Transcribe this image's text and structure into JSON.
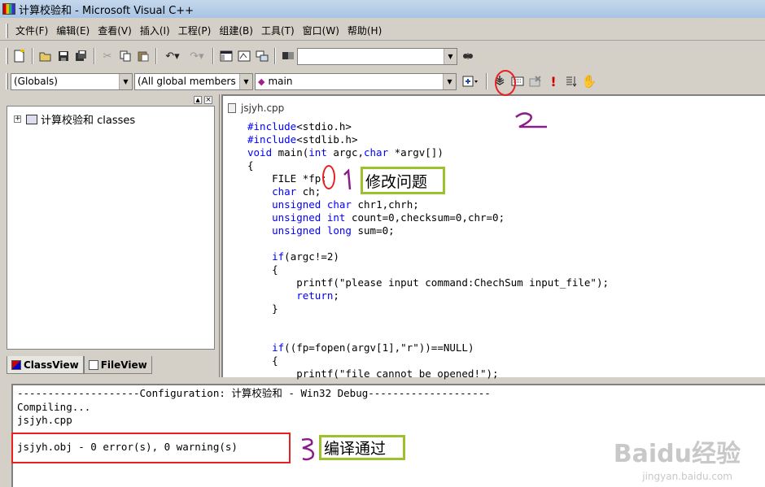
{
  "window": {
    "title": "计算校验和 - Microsoft Visual C++"
  },
  "menu": [
    "文件(F)",
    "编辑(E)",
    "查看(V)",
    "插入(I)",
    "工程(P)",
    "组建(B)",
    "工具(T)",
    "窗口(W)",
    "帮助(H)"
  ],
  "toolbar": {
    "find_combo_value": "",
    "globals_combo": "(Globals)",
    "members_combo": "(All global members",
    "function_combo": "main"
  },
  "workspace": {
    "tree_root": "计算校验和 classes",
    "tabs": [
      "ClassView",
      "FileView"
    ]
  },
  "editor": {
    "filename": "jsjyh.cpp",
    "lines": [
      [
        {
          "t": "#include",
          "k": 1
        },
        {
          "t": "<stdio.h>"
        }
      ],
      [
        {
          "t": "#include",
          "k": 1
        },
        {
          "t": "<stdlib.h>"
        }
      ],
      [
        {
          "t": "void",
          "k": 1
        },
        {
          "t": " main("
        },
        {
          "t": "int",
          "k": 1
        },
        {
          "t": " argc,"
        },
        {
          "t": "char",
          "k": 1
        },
        {
          "t": " *argv[])"
        }
      ],
      [
        {
          "t": "{"
        }
      ],
      [
        {
          "t": "    FILE *fp;"
        }
      ],
      [
        {
          "t": "    "
        },
        {
          "t": "char",
          "k": 1
        },
        {
          "t": " ch;"
        }
      ],
      [
        {
          "t": "    "
        },
        {
          "t": "unsigned",
          "k": 1
        },
        {
          "t": " "
        },
        {
          "t": "char",
          "k": 1
        },
        {
          "t": " chr1,chrh;"
        }
      ],
      [
        {
          "t": "    "
        },
        {
          "t": "unsigned",
          "k": 1
        },
        {
          "t": " "
        },
        {
          "t": "int",
          "k": 1
        },
        {
          "t": " count=0,checksum=0,chr=0;"
        }
      ],
      [
        {
          "t": "    "
        },
        {
          "t": "unsigned",
          "k": 1
        },
        {
          "t": " "
        },
        {
          "t": "long",
          "k": 1
        },
        {
          "t": " sum=0;"
        }
      ],
      [
        {
          "t": ""
        }
      ],
      [
        {
          "t": "    "
        },
        {
          "t": "if",
          "k": 1
        },
        {
          "t": "(argc!=2)"
        }
      ],
      [
        {
          "t": "    {"
        }
      ],
      [
        {
          "t": "        printf(\"please input command:ChechSum input_file\");"
        }
      ],
      [
        {
          "t": "        "
        },
        {
          "t": "return",
          "k": 1
        },
        {
          "t": ";"
        }
      ],
      [
        {
          "t": "    }"
        }
      ],
      [
        {
          "t": ""
        }
      ],
      [
        {
          "t": ""
        }
      ],
      [
        {
          "t": "    "
        },
        {
          "t": "if",
          "k": 1
        },
        {
          "t": "((fp=fopen(argv[1],\"r\"))==NULL)"
        }
      ],
      [
        {
          "t": "    {"
        }
      ],
      [
        {
          "t": "        printf(\"file cannot be opened!\");"
        }
      ]
    ]
  },
  "output": {
    "lines": [
      "--------------------Configuration: 计算校验和 - Win32 Debug--------------------",
      "Compiling...",
      "jsjyh.cpp",
      "",
      "jsjyh.obj - 0 error(s), 0 warning(s)"
    ]
  },
  "annotations": {
    "note1": "修改问题",
    "note3": "编译通过",
    "mark1": "1",
    "mark2": "2",
    "mark3": "3"
  },
  "watermark": {
    "main": "Baidu经验",
    "sub": "jingyan.baidu.com"
  },
  "colors": {
    "keyword": "#0000ff",
    "annotation_green": "#9bc22d",
    "annotation_red": "#e82020",
    "handwriting": "#8a1d8a"
  }
}
